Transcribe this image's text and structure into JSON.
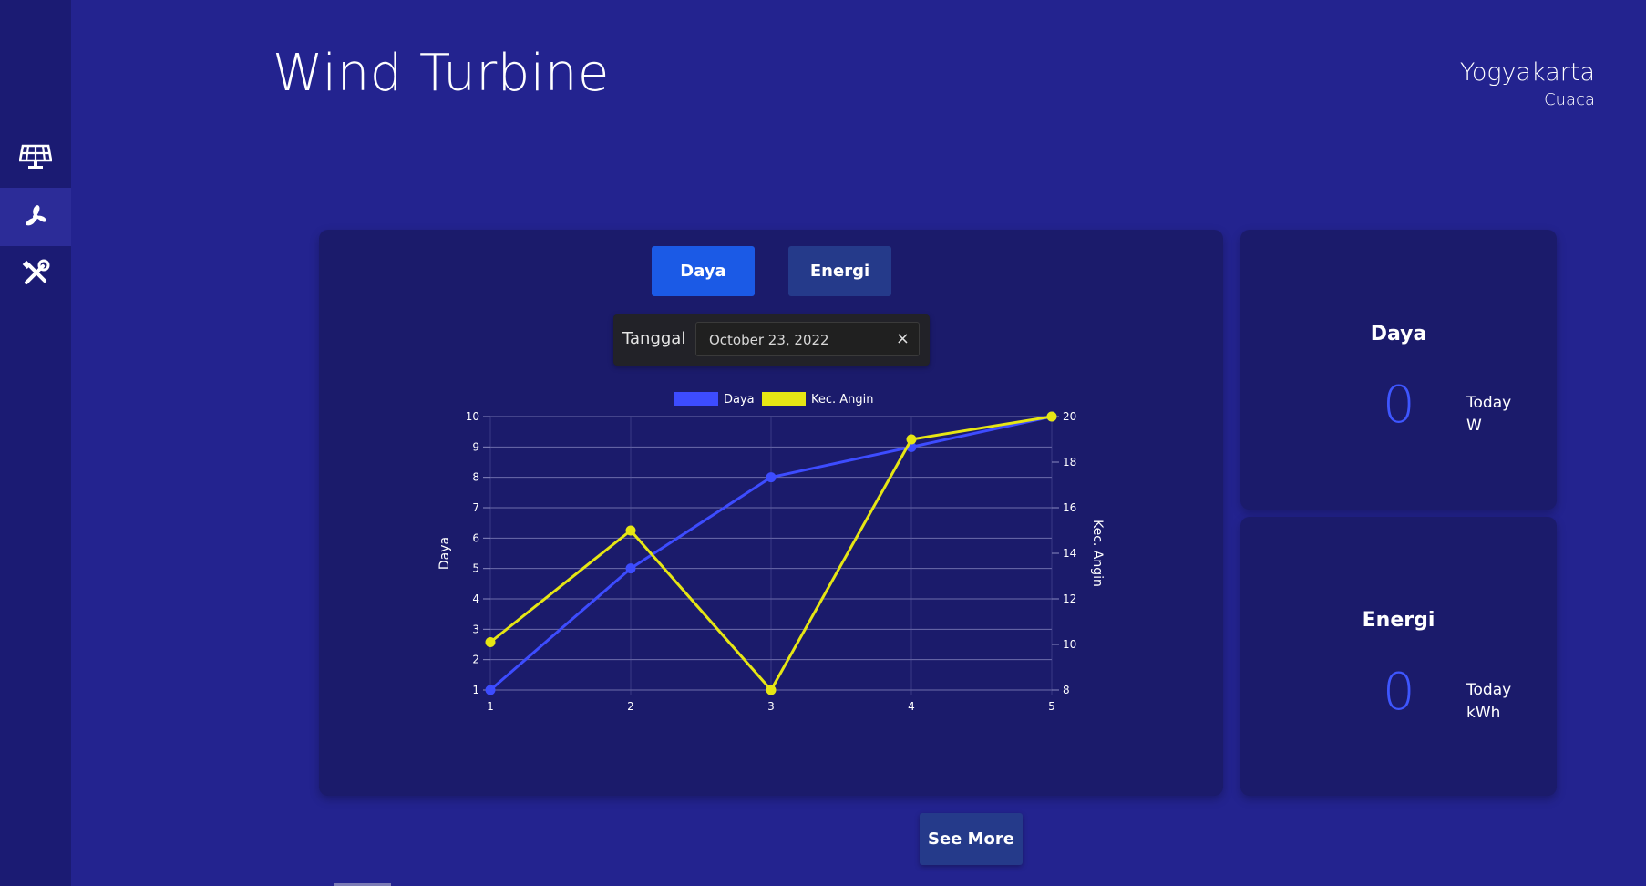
{
  "header": {
    "title": "Wind Turbine",
    "location": "Yogyakarta",
    "weather": "Cuaca"
  },
  "sidebar": {
    "items": [
      {
        "icon": "solar-panel-icon",
        "active": false
      },
      {
        "icon": "wind-turbine-icon",
        "active": true
      },
      {
        "icon": "tools-icon",
        "active": false
      }
    ]
  },
  "tabs": {
    "daya": "Daya",
    "energi": "Energi"
  },
  "date_filter": {
    "label": "Tanggal",
    "value": "October 23, 2022",
    "clear": "×"
  },
  "stats": {
    "daya": {
      "title": "Daya",
      "value": "0",
      "period": "Today",
      "unit": "W"
    },
    "energi": {
      "title": "Energi",
      "value": "0",
      "period": "Today",
      "unit": "kWh"
    }
  },
  "see_more": "See More",
  "colors": {
    "daya": "#3d4cff",
    "kec_angin": "#e6e614",
    "accent_button": "#1b5ae6",
    "secondary_button": "#253a8a"
  },
  "chart_data": {
    "type": "line",
    "x": [
      1,
      2,
      3,
      4,
      5
    ],
    "series": [
      {
        "name": "Daya",
        "axis": "left",
        "values": [
          1,
          5,
          8,
          9,
          10
        ]
      },
      {
        "name": "Kec. Angin",
        "axis": "right",
        "values": [
          10.1,
          15,
          8,
          19,
          20
        ]
      }
    ],
    "ylabel": "Daya",
    "y2label": "Kec. Angin",
    "ylim": [
      1,
      10
    ],
    "y2lim": [
      8,
      20
    ],
    "yticks": [
      1,
      2,
      3,
      4,
      5,
      6,
      7,
      8,
      9,
      10
    ],
    "y2ticks": [
      8,
      10,
      12,
      14,
      16,
      18,
      20
    ],
    "grid": true,
    "legend": "top"
  }
}
